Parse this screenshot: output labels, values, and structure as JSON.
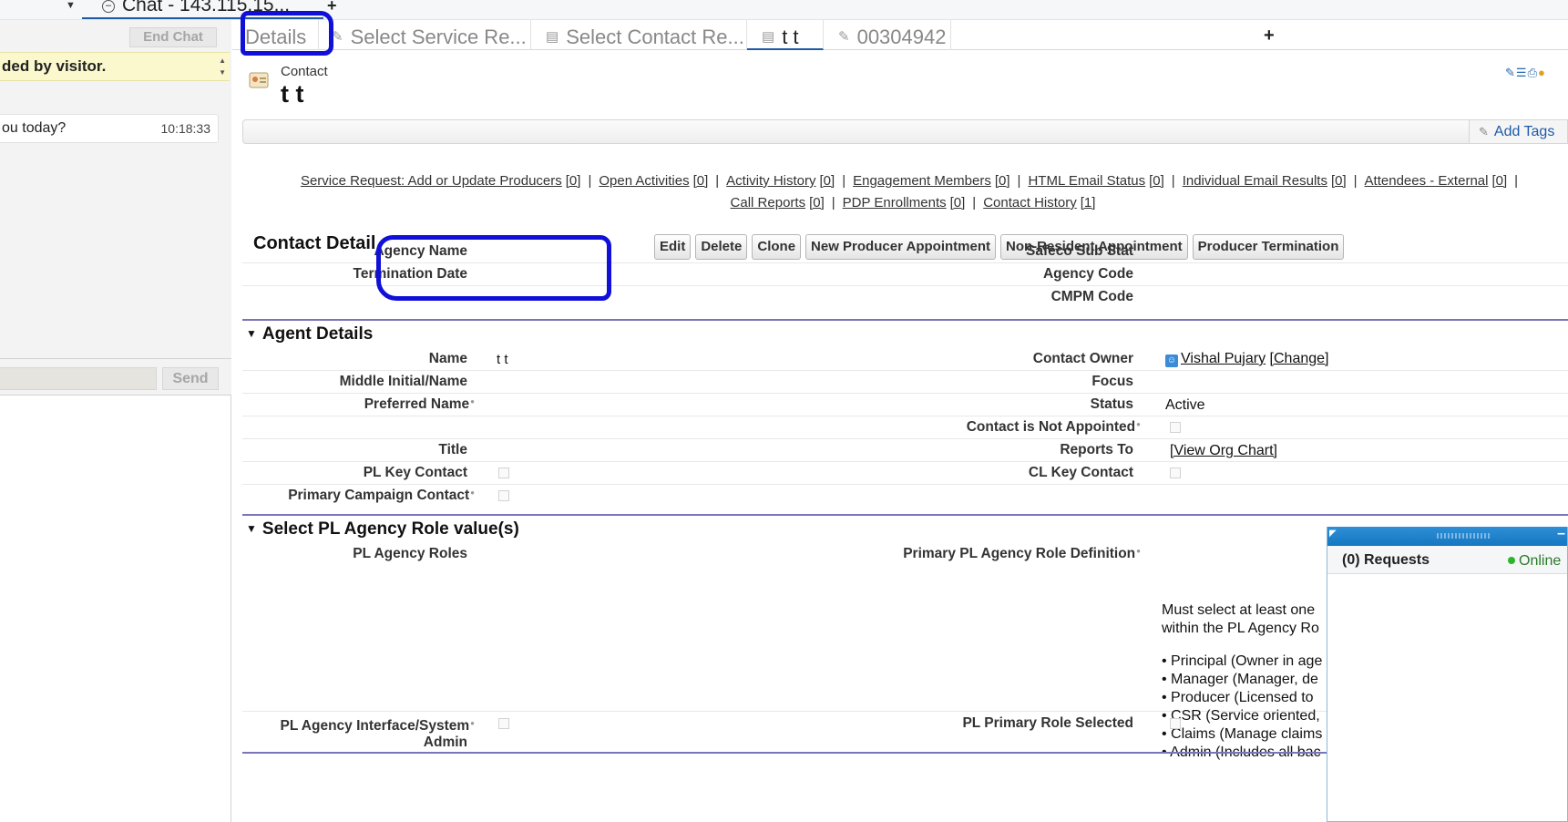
{
  "top_tabs": {
    "chat_tab_label": "Chat - 143.115.15...",
    "add_label": "+"
  },
  "chat": {
    "end_chat_label": "End Chat",
    "banner_text": "ded by visitor.",
    "message_text": "ou today?",
    "message_time": "10:18:33",
    "send_label": "Send"
  },
  "subtabs": [
    {
      "label": "Details",
      "active": false
    },
    {
      "label": "Select Service Re...",
      "active": false
    },
    {
      "label": "Select Contact Re...",
      "active": false
    },
    {
      "label": "t t",
      "active": true
    },
    {
      "label": "00304942",
      "active": false
    }
  ],
  "subtab_add": "+",
  "record": {
    "type": "Contact",
    "name": "t t"
  },
  "tags": {
    "add_tags_label": "Add Tags"
  },
  "related_lists": [
    {
      "label": "Service Request: Add or Update Producers",
      "count": "[0]"
    },
    {
      "label": "Open Activities",
      "count": "[0]"
    },
    {
      "label": "Activity History",
      "count": "[0]"
    },
    {
      "label": "Engagement Members",
      "count": "[0]"
    },
    {
      "label": "HTML Email Status",
      "count": "[0]"
    },
    {
      "label": "Individual Email Results",
      "count": "[0]"
    },
    {
      "label": "Attendees - External",
      "count": "[0]"
    },
    {
      "label": "Call Reports",
      "count": "[0]"
    },
    {
      "label": "PDP Enrollments",
      "count": "[0]"
    },
    {
      "label": "Contact History",
      "count": "[1]"
    }
  ],
  "detail": {
    "title": "Contact Detail",
    "buttons": [
      "Edit",
      "Delete",
      "Clone",
      "New Producer Appointment",
      "Non-Resident Appointment",
      "Producer Termination"
    ],
    "top_fields_left": [
      "Agency Name",
      "Termination Date"
    ],
    "top_fields_right": [
      "Safeco Sub Stat",
      "Agency Code",
      "CMPM Code"
    ]
  },
  "agent_details": {
    "title": "Agent Details",
    "name_label": "Name",
    "name_value": "t t",
    "middle_label": "Middle Initial/Name",
    "preferred_label": "Preferred Name",
    "title_label": "Title",
    "pl_key_label": "PL Key Contact",
    "primary_campaign_label": "Primary Campaign Contact",
    "owner_label": "Contact Owner",
    "owner_value": "Vishal Pujary",
    "owner_change": "[Change]",
    "focus_label": "Focus",
    "status_label": "Status",
    "status_value": "Active",
    "not_appointed_label": "Contact is Not Appointed",
    "reports_to_label": "Reports To",
    "reports_to_value": "[View Org Chart]",
    "cl_key_label": "CL Key Contact"
  },
  "pl_roles": {
    "title": "Select PL Agency Role value(s)",
    "roles_label": "PL Agency Roles",
    "definition_label": "Primary PL Agency Role Definition",
    "definition_lines": [
      "Must select at least one",
      "within the PL Agency Ro"
    ],
    "definition_bullets": [
      "• Principal (Owner in age",
      "• Manager (Manager, de",
      "• Producer (Licensed to",
      "• CSR (Service oriented,",
      "• Claims (Manage claims",
      "• Admin (Includes all bac"
    ],
    "interface_label_1": "PL Agency Interface/System",
    "interface_label_2": "Admin",
    "primary_role_label": "PL Primary Role Selected"
  },
  "omni": {
    "requests_label": "(0) Requests",
    "status_label": "Online"
  },
  "colors": {
    "accent": "#1e5aa8",
    "section_rule": "#7a74b8",
    "annotation": "#1010d8",
    "omni_header": "#1677c2"
  }
}
